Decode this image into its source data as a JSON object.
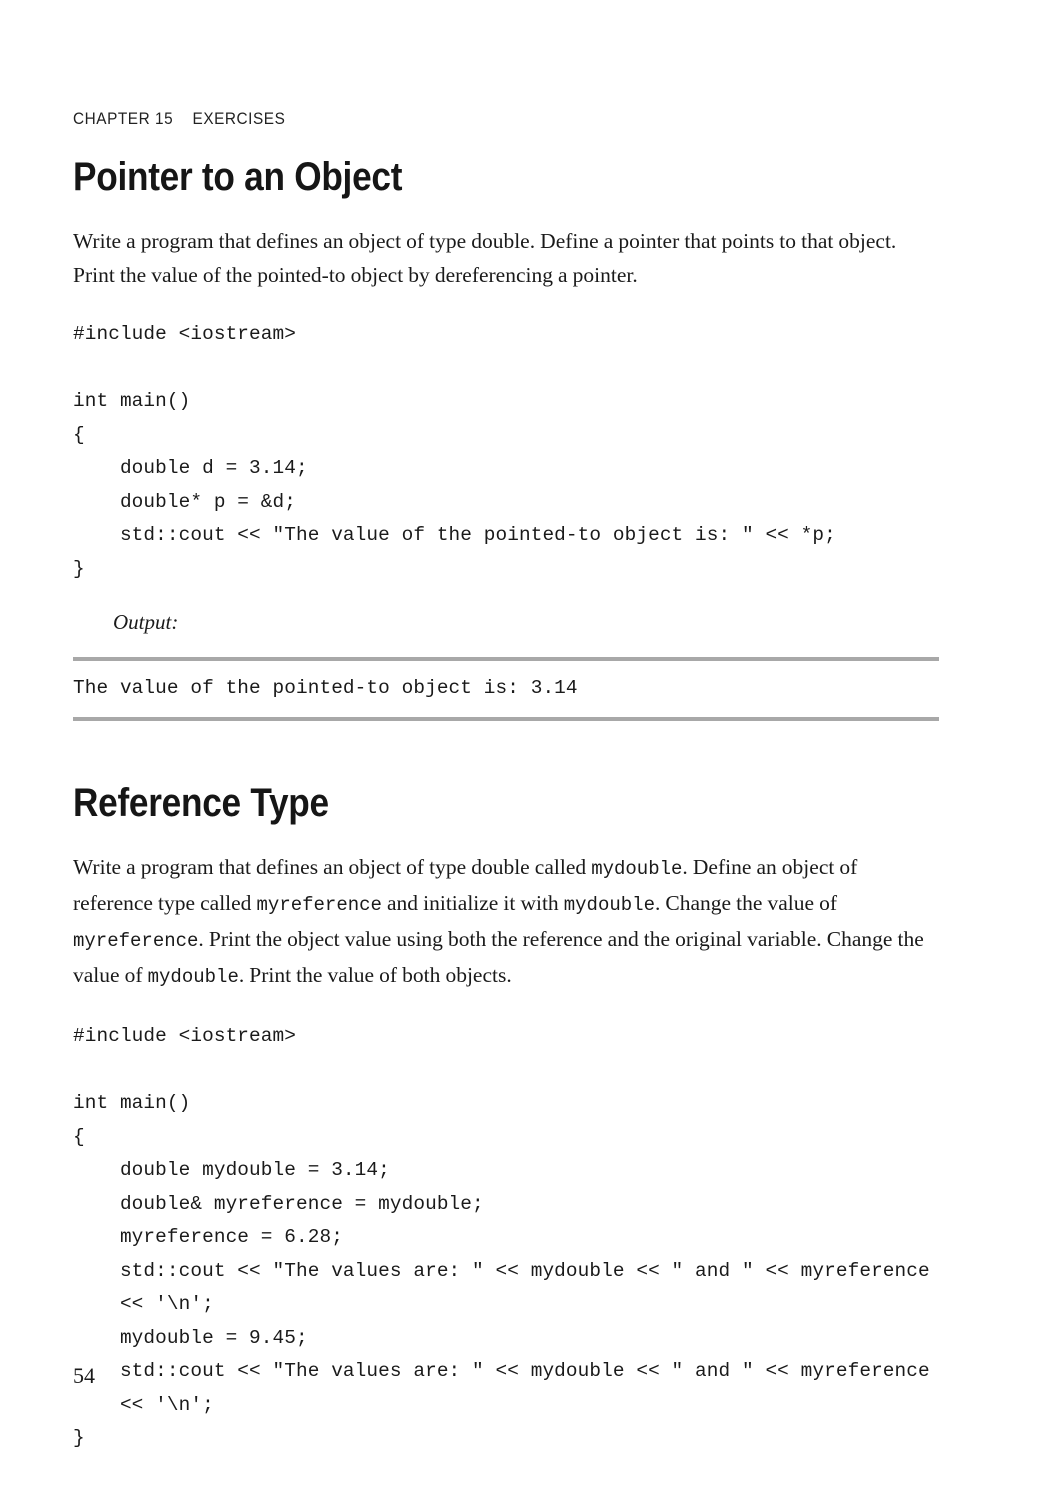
{
  "page": {
    "running_head": "CHAPTER 15    EXERCISES",
    "folio": "54",
    "rule_color": "#a8a8a8",
    "text_color": "#1a1a1a",
    "background": "#ffffff"
  },
  "sections": [
    {
      "title": "Pointer to an Object",
      "paragraph": "Write a program that defines an object of type double. Define a pointer that points to that object. Print the value of the pointed-to object by dereferencing a pointer.",
      "code": "#include <iostream>\n\nint main()\n{\n    double d = 3.14;\n    double* p = &d;\n    std::cout << \"The value of the pointed-to object is: \" << *p;\n}",
      "output_label": "Output:",
      "output": "The value of the pointed-to object is: 3.14"
    },
    {
      "title": "Reference Type",
      "paragraph_parts": [
        {
          "type": "text",
          "value": "Write a program that defines an object of type double called "
        },
        {
          "type": "code",
          "value": "mydouble"
        },
        {
          "type": "text",
          "value": ". Define an object of reference type called "
        },
        {
          "type": "code",
          "value": "myreference"
        },
        {
          "type": "text",
          "value": " and initialize it with "
        },
        {
          "type": "code",
          "value": "mydouble"
        },
        {
          "type": "text",
          "value": ". Change the value of "
        },
        {
          "type": "code",
          "value": "myreference"
        },
        {
          "type": "text",
          "value": ". Print the object value using both the reference and the original variable. Change the value of "
        },
        {
          "type": "code",
          "value": "mydouble"
        },
        {
          "type": "text",
          "value": ". Print the value of both objects."
        }
      ],
      "code": "#include <iostream>\n\nint main()\n{\n    double mydouble = 3.14;\n    double& myreference = mydouble;\n    myreference = 6.28;\n    std::cout << \"The values are: \" << mydouble << \" and \" << myreference\n    << '\\n';\n    mydouble = 9.45;\n    std::cout << \"The values are: \" << mydouble << \" and \" << myreference\n    << '\\n';\n}"
    }
  ]
}
